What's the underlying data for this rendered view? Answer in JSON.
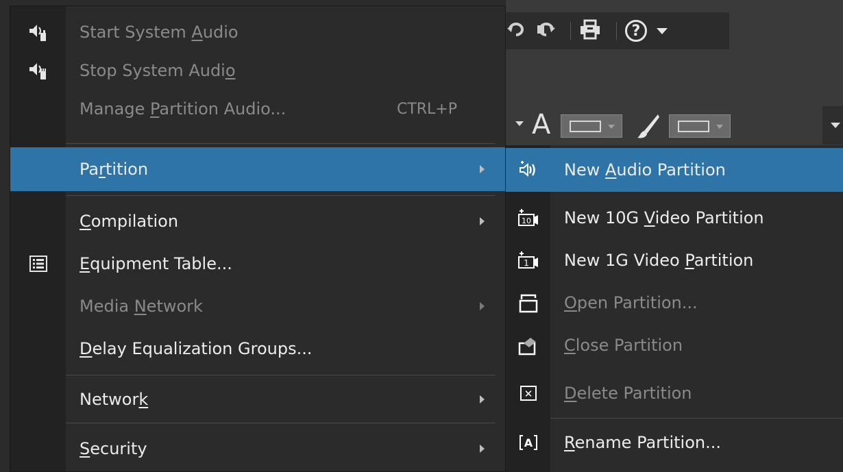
{
  "toolbar": {
    "undo_icon": "undo-icon",
    "redo_icon": "redo-icon",
    "print_icon": "print-icon",
    "help_label": "?",
    "text_tool_label": "A"
  },
  "menu": {
    "items": [
      {
        "pre": "Start System ",
        "key": "A",
        "post": "udio",
        "accel": "",
        "disabled": true,
        "submenu": false,
        "icon": "speaker-hand-icon"
      },
      {
        "pre": "Stop System Audi",
        "key": "o",
        "post": "",
        "accel": "",
        "disabled": true,
        "submenu": false,
        "icon": "speaker-stop-icon"
      },
      {
        "pre": "Manage ",
        "key": "P",
        "post": "artition Audio...",
        "accel": "CTRL+P",
        "disabled": true,
        "submenu": false,
        "icon": ""
      },
      {
        "pre": "Pa",
        "key": "r",
        "post": "tition",
        "accel": "",
        "disabled": false,
        "submenu": true,
        "icon": ""
      },
      {
        "pre": "",
        "key": "C",
        "post": "ompilation",
        "accel": "",
        "disabled": false,
        "submenu": true,
        "icon": ""
      },
      {
        "pre": "",
        "key": "E",
        "post": "quipment Table...",
        "accel": "",
        "disabled": false,
        "submenu": false,
        "icon": "list-icon"
      },
      {
        "pre": "Media ",
        "key": "N",
        "post": "etwork",
        "accel": "",
        "disabled": true,
        "submenu": true,
        "icon": ""
      },
      {
        "pre": "",
        "key": "D",
        "post": "elay Equalization Groups...",
        "accel": "",
        "disabled": false,
        "submenu": false,
        "icon": ""
      },
      {
        "pre": "Networ",
        "key": "k",
        "post": "",
        "accel": "",
        "disabled": false,
        "submenu": true,
        "icon": ""
      },
      {
        "pre": "",
        "key": "S",
        "post": "ecurity",
        "accel": "",
        "disabled": false,
        "submenu": true,
        "icon": ""
      }
    ]
  },
  "submenu": {
    "items": [
      {
        "pre": "New ",
        "key": "A",
        "post": "udio Partition",
        "disabled": false,
        "icon": "audio-partition-icon"
      },
      {
        "pre": "New 10G ",
        "key": "V",
        "post": "ideo Partition",
        "disabled": false,
        "icon": "video-10g-icon"
      },
      {
        "pre": "New 1G Video ",
        "key": "P",
        "post": "artition",
        "disabled": false,
        "icon": "video-1g-icon"
      },
      {
        "pre": "",
        "key": "O",
        "post": "pen Partition...",
        "disabled": true,
        "icon": "open-partition-icon"
      },
      {
        "pre": "",
        "key": "C",
        "post": "lose Partition",
        "disabled": true,
        "icon": "close-partition-icon"
      },
      {
        "pre": "",
        "key": "D",
        "post": "elete Partition",
        "disabled": true,
        "icon": "delete-partition-icon"
      },
      {
        "pre": "",
        "key": "R",
        "post": "ename Partition...",
        "disabled": false,
        "icon": "rename-partition-icon"
      }
    ]
  },
  "icon_glyphs": {
    "video_10g": "10",
    "video_1g": "1",
    "delete": "✕",
    "rename": "A"
  }
}
